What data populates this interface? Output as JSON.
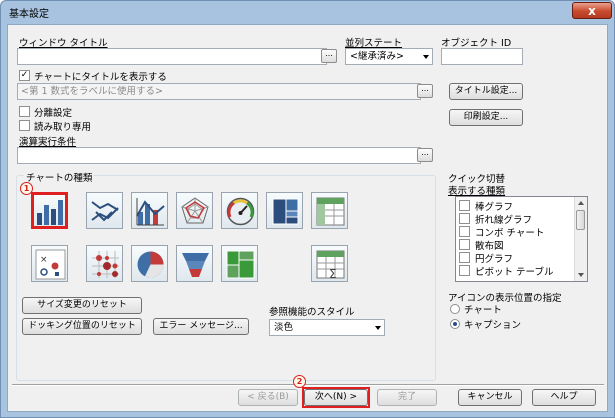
{
  "window": {
    "title": "基本設定",
    "close_label": "x"
  },
  "fields": {
    "window_title_label": "ウィンドウ タイトル",
    "window_title_value": "",
    "sort_state_label": "並列ステート",
    "sort_state_value": "<継承済み>",
    "object_id_label": "オブジェクト ID",
    "object_id_value": "",
    "show_title_label": "チャートにタイトルを表示する",
    "show_title_checked": "✓",
    "title_placeholder": "<第 1 数式をラベルに使用する>",
    "title_settings_btn": "タイトル設定...",
    "split_label": "分離設定",
    "readonly_label": "読み取り専用",
    "print_settings_btn": "印刷設定...",
    "calc_condition_label": "演算実行条件",
    "calc_condition_value": "",
    "dots": "..."
  },
  "chart_types": {
    "label": "チャートの種類",
    "icons": [
      {
        "name": "bar-chart-icon"
      },
      {
        "name": "line-chart-icon"
      },
      {
        "name": "combo-chart-icon"
      },
      {
        "name": "radar-chart-icon"
      },
      {
        "name": "gauge-chart-icon"
      },
      {
        "name": "block-chart-icon"
      },
      {
        "name": "pivot-table-icon"
      },
      {
        "name": "scatter-chart-icon"
      },
      {
        "name": "grid-chart-icon"
      },
      {
        "name": "pie-chart-icon"
      },
      {
        "name": "funnel-chart-icon"
      },
      {
        "name": "mekko-chart-icon"
      },
      {
        "name": "straight-table-icon"
      }
    ]
  },
  "quick_switch": {
    "label": "クイック切替",
    "list_label": "表示する種類",
    "items": [
      "棒グラフ",
      "折れ線グラフ",
      "コンボ チャート",
      "散布図",
      "円グラフ",
      "ピボット テーブル"
    ]
  },
  "icon_position": {
    "label": "アイコンの表示位置の指定",
    "options": [
      "チャート",
      "キャプション"
    ],
    "selected": "キャプション"
  },
  "reference": {
    "label": "参照機能のスタイル",
    "value": "淡色"
  },
  "buttons": {
    "reset_size": "サイズ変更のリセット",
    "reset_docking": "ドッキング位置のリセット",
    "error_messages": "エラー メッセージ...",
    "back": "< 戻る(B)",
    "next": "次へ(N) >",
    "finish": "完了",
    "cancel": "キャンセル",
    "help": "ヘルプ"
  },
  "markers": {
    "one": "1",
    "two": "2"
  },
  "colors": {
    "highlight": "#e02020",
    "window_frame": "#a7c3df"
  }
}
